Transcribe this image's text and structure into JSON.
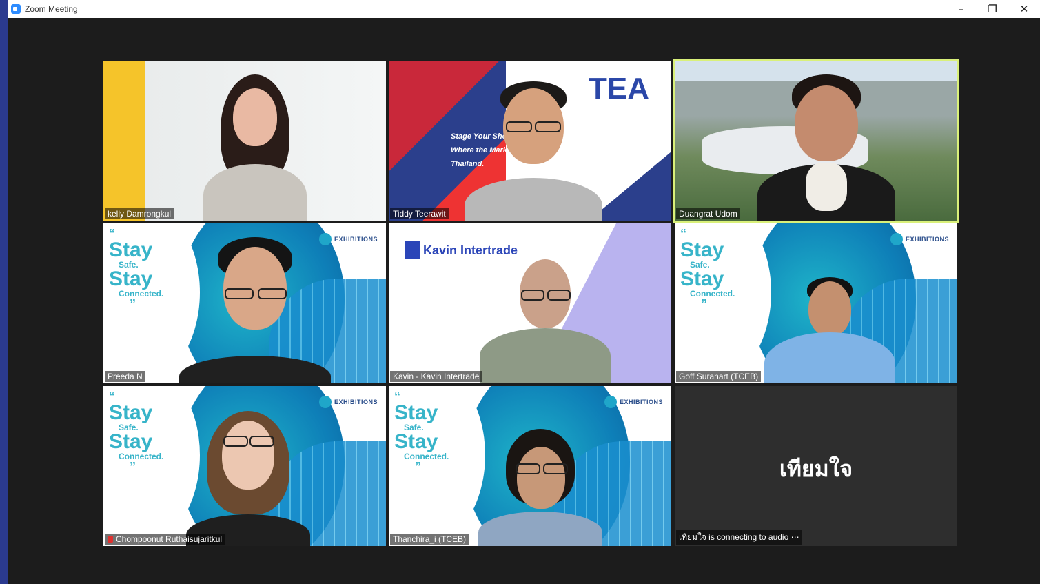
{
  "window": {
    "title": "Zoom Meeting",
    "controls": {
      "minimize": "–",
      "maximize": "❐",
      "close": "✕"
    }
  },
  "participants": [
    {
      "name": "kelly Damrongkul",
      "background": "office"
    },
    {
      "name": "Tiddy Teerawit",
      "background": "TEA"
    },
    {
      "name": "Duangrat Udom",
      "background": "city",
      "active_speaker": true
    },
    {
      "name": "Preeda N",
      "background": "stay-safe"
    },
    {
      "name": "Kavin - Kavin Intertrade",
      "background": "kavin"
    },
    {
      "name": "Goff Suranart (TCEB)",
      "background": "stay-safe"
    },
    {
      "name": "Chompoonut Ruthaisujaritkul",
      "background": "stay-safe",
      "muted": true
    },
    {
      "name": "Thanchira_i (TCEB)",
      "background": "stay-safe"
    },
    {
      "name": "เทียมใจ is connecting to audio ⋯",
      "display_name": "เทียมใจ",
      "background": "none"
    }
  ],
  "backgrounds": {
    "tea": {
      "logo": "TEA",
      "slogan_lines": [
        "Stage Your Sho",
        "Where the Mark",
        "Thailand."
      ]
    },
    "kavin": {
      "logo": "Kavin Intertrade"
    },
    "stay_safe": {
      "quote_open": "“",
      "line1": "Stay",
      "line2": "Safe.",
      "line3": "Stay",
      "line4": "Connected.",
      "quote_close": "”",
      "logo": "EXHIBITIONS"
    }
  },
  "colors": {
    "active_speaker_border": "#d9f07a",
    "window_bg": "#1c1c1c",
    "muted_icon": "#e0312f"
  }
}
